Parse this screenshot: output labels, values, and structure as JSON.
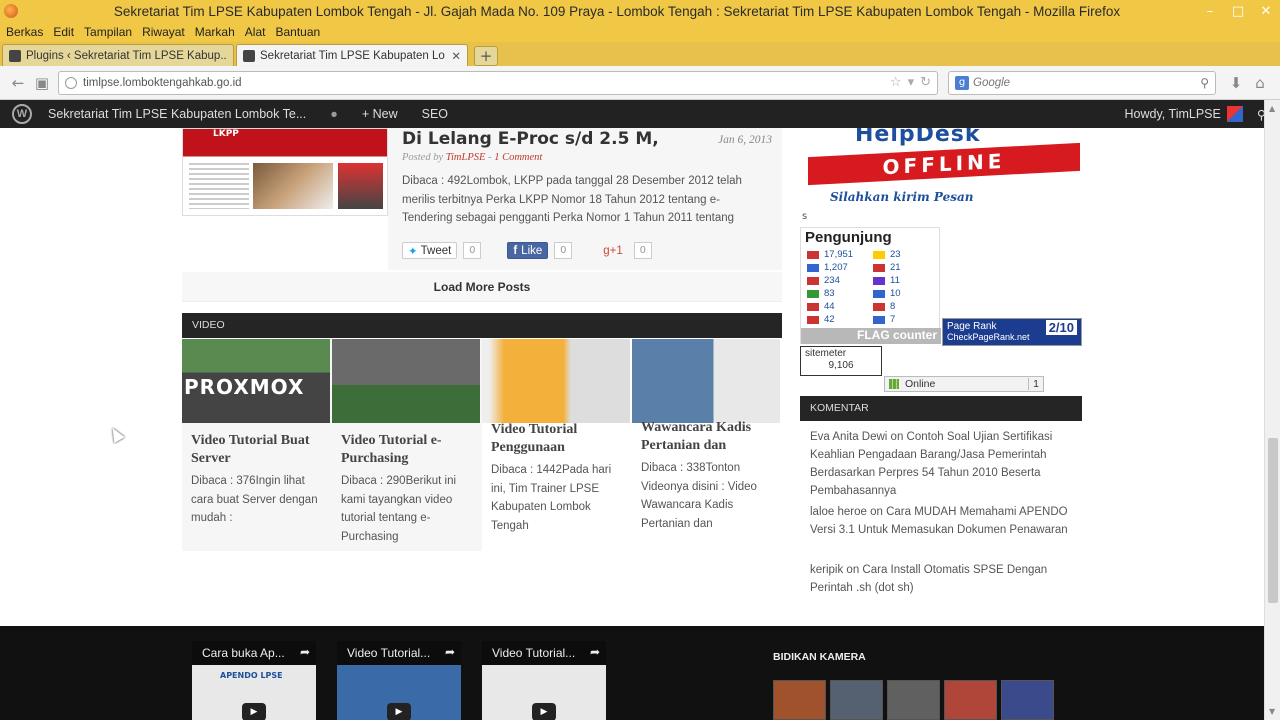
{
  "window": {
    "title": "Sekretariat Tim LPSE Kabupaten Lombok Tengah - Jl. Gajah Mada No. 109 Praya - Lombok Tengah : Sekretariat Tim LPSE Kabupaten Lombok Tengah - Mozilla Firefox",
    "minimize": "–",
    "maximize": "□",
    "close": "✕"
  },
  "menu": [
    "Berkas",
    "Edit",
    "Tampilan",
    "Riwayat",
    "Markah",
    "Alat",
    "Bantuan"
  ],
  "tabs": [
    {
      "label": "Plugins ‹ Sekretariat Tim LPSE Kabup...",
      "close": ""
    },
    {
      "label": "Sekretariat Tim LPSE Kabupaten Lom...",
      "close": "✕"
    }
  ],
  "newtab": "+",
  "nav": {
    "url": "timlpse.lomboktengahkab.go.id",
    "search_placeholder": "Google",
    "search_engine": "g"
  },
  "wpbar": {
    "site": "Sekretariat Tim LPSE Kabupaten Lombok Te...",
    "comments": "",
    "new": "New",
    "seo": "SEO",
    "howdy": "Howdy, TimLPSE"
  },
  "post": {
    "title": "Di Lelang E-Proc s/d 2.5 M,",
    "date": "Jan 6, 2013",
    "meta_prefix": "Posted by ",
    "author": "TimLPSE",
    "comment": "1 Comment",
    "excerpt": "Dibaca : 492Lombok, LKPP pada tanggal 28 Desember 2012 telah merilis terbitnya  Perka LKPP Nomor 18 Tahun 2012 tentang e-Tendering sebagai pengganti Perka Nomor 1 Tahun 2011 tentang",
    "tweet": "Tweet",
    "tweet_count": "0",
    "like": "Like",
    "like_count": "0",
    "gplus": "g+1",
    "gplus_count": "0",
    "image_title": "LKPP"
  },
  "load_more": "Load More Posts",
  "video_section": "VIDEO",
  "videos": [
    {
      "title": "Video Tutorial Buat Server",
      "excerpt": "Dibaca : 376Ingin lihat cara buat Server dengan mudah :",
      "thumb_text": "PROXMOX"
    },
    {
      "title": "Video Tutorial e-Purchasing",
      "excerpt": "Dibaca : 290Berikut ini kami tayangkan video tutorial tentang e-Purchasing",
      "thumb_text": ""
    },
    {
      "title": "Video Tutorial Penggunaan",
      "excerpt": "Dibaca : 1442Pada hari ini, Tim Trainer LPSE Kabupaten Lombok Tengah",
      "thumb_text": ""
    },
    {
      "title": "Wawancara Kadis Pertanian dan",
      "excerpt": "Dibaca : 338Tonton Videonya disini : Video Wawancara Kadis Pertanian dan",
      "thumb_text": ""
    }
  ],
  "sidebar": {
    "helpdesk_title": "HelpDesk",
    "helpdesk_status": "OFFLINE",
    "helpdesk_msg": "Silahkan kirim Pesan",
    "s_letter": "s",
    "visitors_title": "Pengunjung",
    "visitors_left": [
      {
        "flag_color": "#c33",
        "count": "17,951"
      },
      {
        "flag_color": "#36c",
        "count": "1,207"
      },
      {
        "flag_color": "#c33",
        "count": "234"
      },
      {
        "flag_color": "#393",
        "count": "83"
      },
      {
        "flag_color": "#c33",
        "count": "44"
      },
      {
        "flag_color": "#c33",
        "count": "42"
      }
    ],
    "visitors_right": [
      {
        "flag_color": "#fc0",
        "count": "23"
      },
      {
        "flag_color": "#c33",
        "count": "21"
      },
      {
        "flag_color": "#63c",
        "count": "11"
      },
      {
        "flag_color": "#36c",
        "count": "10"
      },
      {
        "flag_color": "#c33",
        "count": "8"
      },
      {
        "flag_color": "#36c",
        "count": "7"
      }
    ],
    "flag_counter": "FLAG counter",
    "pagerank_label": "Page Rank",
    "pagerank_value": "2/10",
    "pagerank_site": "CheckPageRank.net",
    "sitemeter": "sitemeter",
    "sitemeter_count": "9,106",
    "online_label": "Online",
    "online_count": "1",
    "comments_title": "KOMENTAR",
    "comments": [
      {
        "author": "Eva Anita Dewi",
        "on": " on ",
        "post": "Contoh Soal Ujian Sertifikasi Keahlian Pengadaan Barang/Jasa Pemerintah Berdasarkan Perpres 54 Tahun 2010 Beserta Pembahasannya"
      },
      {
        "author": "laloe heroe",
        "on": " on ",
        "post": "Cara MUDAH Memahami APENDO Versi 3.1 Untuk Memasukan Dokumen Penawaran"
      },
      {
        "author": "keripik",
        "on": " on ",
        "post": "Cara Install Otomatis SPSE Dengan Perintah .sh (dot sh)"
      }
    ]
  },
  "footer": {
    "videos": [
      {
        "title": "Cara buka Ap...",
        "thumb_text": "APENDO LPSE"
      },
      {
        "title": "Video Tutorial...",
        "thumb_text": ""
      },
      {
        "title": "Video Tutorial...",
        "thumb_text": ""
      }
    ],
    "share_icon": "share-icon",
    "camera_title": "BIDIKAN KAMERA",
    "camera_colors": [
      "#a0522d",
      "#556070",
      "#606060",
      "#b0463a",
      "#3a4a8a"
    ]
  },
  "colors": {
    "firefox_accent": "#f0c846",
    "wp_bar": "#222222",
    "link_red": "#c0392b"
  }
}
